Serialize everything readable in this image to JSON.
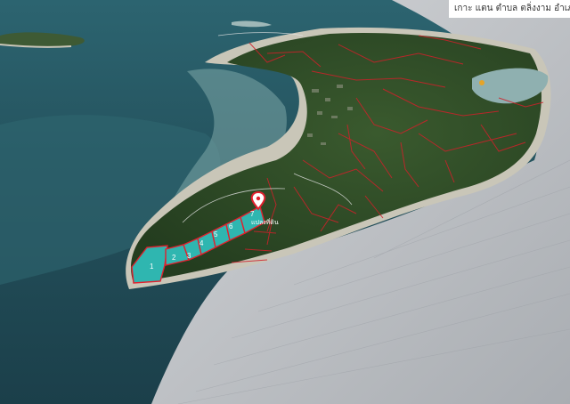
{
  "map": {
    "caption": "เกาะ แตน ตำบล ตลิ่งงาม อำเภอเกาะสมุย สุราษฎร์ธานี",
    "plots": [
      {
        "label": "1"
      },
      {
        "label": "2"
      },
      {
        "label": "3"
      },
      {
        "label": "4"
      },
      {
        "label": "5"
      },
      {
        "label": "6"
      },
      {
        "label": "7"
      }
    ],
    "area_label": "แปลงที่ดิน",
    "colors": {
      "sea": "#1f4a56",
      "shallow_water": "#6f9aa0",
      "forest": "#2e4a26",
      "sand": "#c9c6b8",
      "plot_fill": "#2fb6b0",
      "plot_border": "#e0202e",
      "boundary_lines": "#d0202a",
      "haze": "#b9bcc0"
    },
    "icons": [
      "location-pin-icon"
    ]
  }
}
